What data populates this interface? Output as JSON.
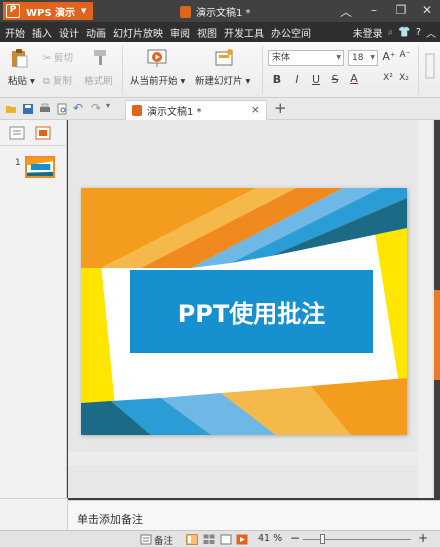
{
  "titlebar": {
    "app_name": "WPS 演示",
    "app_logo": "P",
    "doc_title": "演示文稿1 *",
    "controls": [
      "chevron-up-icon",
      "minimize-icon",
      "restore-icon",
      "close-icon"
    ]
  },
  "menu": {
    "items": [
      "开始",
      "插入",
      "设计",
      "动画",
      "幻灯片放映",
      "审阅",
      "视图",
      "开发工具",
      "办公空间"
    ],
    "login": "未登录"
  },
  "ribbon": {
    "paste": "粘贴",
    "cut": "剪切",
    "copy": "复制",
    "format_painter": "格式刷",
    "from_current": "从当前开始",
    "new_slide": "新建幻灯片",
    "font_name": "宋体",
    "font_size": "18",
    "bold": "B",
    "italic": "I",
    "underline": "U",
    "strike": "S",
    "font_color": "A",
    "grow": "A⁺",
    "shrink": "A⁻",
    "superscript": "X²",
    "subscript": "X₂"
  },
  "tabs": {
    "doc_tab": "演示文稿1 *",
    "close": "×",
    "add": "+"
  },
  "thumbnails": [
    {
      "number": "1"
    }
  ],
  "slide": {
    "title": "PPT使用批注"
  },
  "notes": {
    "placeholder": "单击添加备注"
  },
  "status": {
    "notes_label": "备注",
    "zoom": "41 %",
    "zoom_level": 0.41
  },
  "colors": {
    "accent_orange": "#e0641e",
    "slide_blue": "#1690cf",
    "stripe_yellow": "#ffe600",
    "stripe_orange": "#f39c1e",
    "stripe_lightblue": "#6fb7e6",
    "stripe_darkteal": "#1b6b87"
  }
}
